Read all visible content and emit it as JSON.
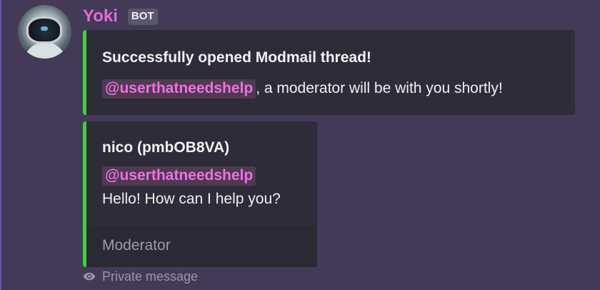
{
  "message": {
    "author": "Yoki",
    "badge": "BOT",
    "embeds": [
      {
        "title": "Successfully opened Modmail thread!",
        "mention": "@userthatneedshelp",
        "text": ", a moderator will be with you shortly!"
      },
      {
        "title": "nico (pmbOB8VA)",
        "mention": "@userthatneedshelp",
        "text": "Hello! How can I help you?",
        "footer": "Moderator"
      }
    ],
    "visibility": "Private message",
    "accent_color": "#3ed23a",
    "author_color": "#e36bd6",
    "mention_color": "#f06fe3"
  }
}
